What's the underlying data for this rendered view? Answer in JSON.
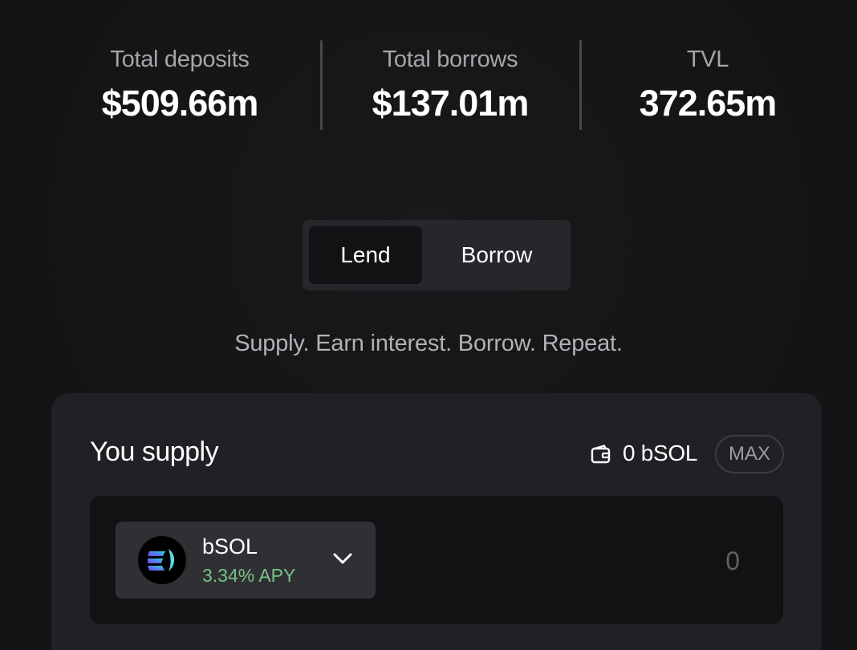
{
  "stats": {
    "deposits": {
      "label": "Total deposits",
      "value": "$509.66m"
    },
    "borrows": {
      "label": "Total borrows",
      "value": "$137.01m"
    },
    "tvl": {
      "label": "TVL",
      "value": "372.65m"
    }
  },
  "toggle": {
    "lend_label": "Lend",
    "borrow_label": "Borrow",
    "active": "Lend"
  },
  "tagline": "Supply. Earn interest. Borrow. Repeat.",
  "supply": {
    "title": "You supply",
    "wallet_balance": "0 bSOL",
    "max_label": "MAX",
    "token": {
      "name": "bSOL",
      "apy": "3.34% APY",
      "icon": "bsol-logo-icon"
    },
    "amount_placeholder": "0"
  },
  "colors": {
    "background": "#141516",
    "card": "#1f2124",
    "apy_green": "#78c28a",
    "muted_text": "#a4a6a9"
  }
}
